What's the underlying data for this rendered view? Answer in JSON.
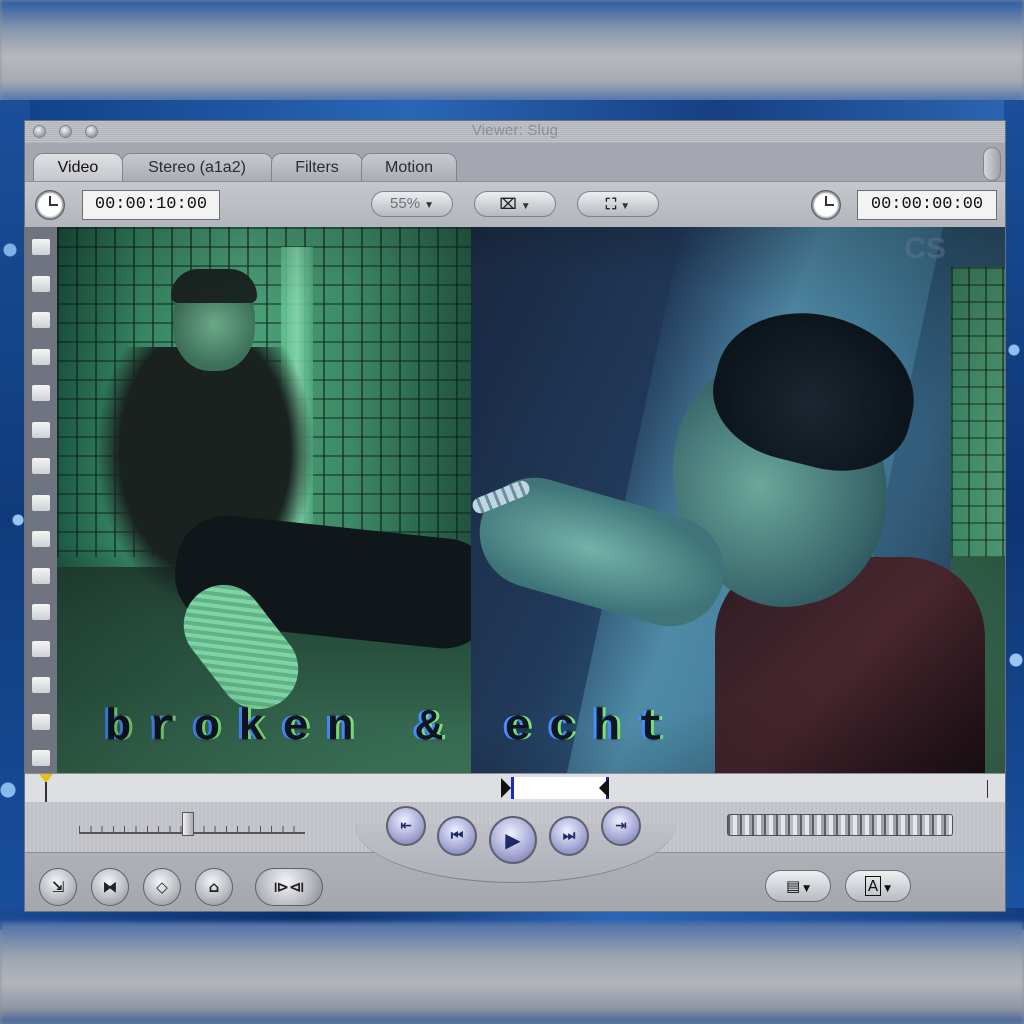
{
  "window": {
    "title": "Viewer: Slug"
  },
  "tabs": [
    {
      "label": "Video",
      "active": true
    },
    {
      "label": "Stereo (a1a2)",
      "active": false
    },
    {
      "label": "Filters",
      "active": false
    },
    {
      "label": "Motion",
      "active": false
    }
  ],
  "controls": {
    "duration_timecode": "00:00:10:00",
    "zoom_label": "55%",
    "view_options_symbol": "⌧",
    "overlay_symbol": "⛶",
    "current_timecode": "00:00:00:00"
  },
  "video": {
    "caption": "broken & echt",
    "watermark": "CS"
  },
  "scrubber": {
    "playhead_position": 0.0,
    "in_point_fraction": 0.5,
    "out_point_fraction": 0.59
  },
  "transport": {
    "shuttle_level": 0.5,
    "buttons": {
      "prev_edit": "⇤",
      "play_in_to_out": "⏮",
      "play": "▶",
      "play_around": "⏭",
      "next_edit": "⇥"
    }
  },
  "bottom_buttons": {
    "match_frame": "⇲",
    "mark_clip": "⧓",
    "add_keyframe": "◇",
    "add_marker": "⌂",
    "mark_in_out": "⧐⧏",
    "recent_clips": "▤",
    "generators": "A"
  },
  "colors": {
    "in_out_marker": "#1a26c8",
    "playhead": "#e1c01e",
    "transport_accent": "#a8acd6"
  }
}
